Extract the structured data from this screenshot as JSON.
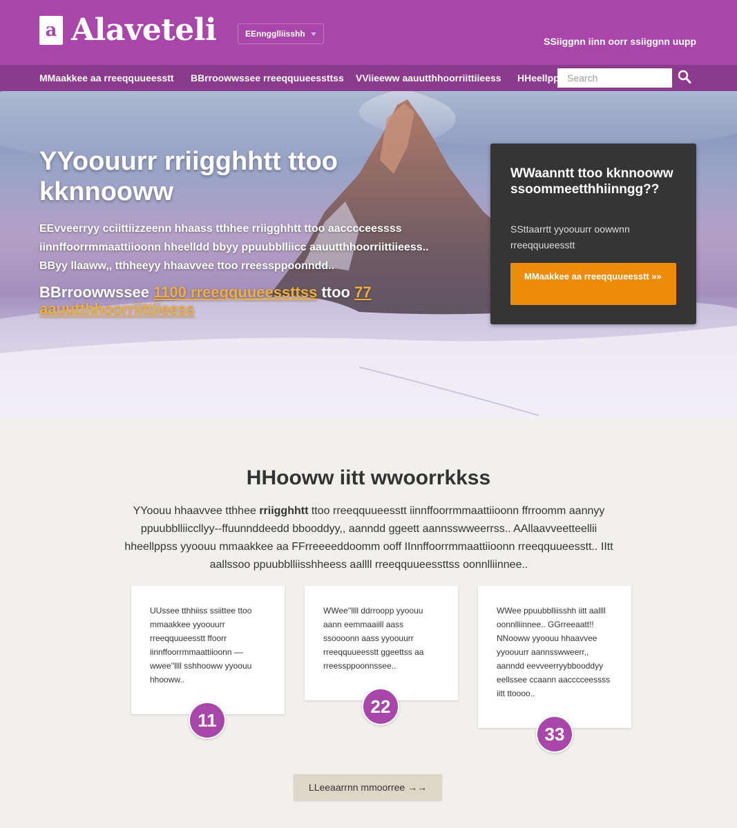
{
  "header": {
    "logo_glyph": "a",
    "logo_text": "Alaveteli",
    "language": "EEnngglliisshh",
    "signin": "SSiiggnn iinn oorr ssiiggnn uupp"
  },
  "nav": {
    "items": [
      "MMaakkee aa rreeqquueesstt",
      "BBrroowwssee rreeqquueessttss",
      "VViieeww aauutthhoorriittiieess",
      "HHeellpp"
    ],
    "search_placeholder": "Search",
    "search_icon": "search-icon"
  },
  "hero": {
    "title": "YYoouurr rriigghhtt ttoo kknnooww",
    "text": "EEvveerryy cciittiizzeenn hhaass tthhee rriigghhtt ttoo aacccceessss iinnffoorrmmaattiioonn hheelldd bbyy ppuubblliicc aauutthhoorriittiieess.. BByy llaaww,, tthheeyy hhaavvee ttoo rreessppoonndd..",
    "browse_prefix": "BBrroowwssee",
    "requests_link": "1100 rreeqquueessttss",
    "to_word": "ttoo",
    "authorities_link": "77 aauutthhoorriittiieess"
  },
  "cta": {
    "title": "WWaanntt ttoo kknnooww ssoommeetthhiinngg??",
    "text": "SSttaarrtt yyoouurr oowwnn rreeqquueesstt",
    "button": "MMaakkee aa rreeqquueesstt »»"
  },
  "how": {
    "title": "HHooww iitt wwoorrkkss",
    "text_start": "YYoouu hhaavvee tthhee",
    "text_bold": "rriigghhtt",
    "text_end": "ttoo rreeqquueesstt iinnffoorrmmaattiioonn ffrroomm aannyy ppuubblliiccllyy--ffuunnddeedd bbooddyy,, aanndd ggeett aannsswweerrss.. AAllaavveetteellii hheellppss yyoouu mmaakkee aa FFrreeeeddoomm ooff IInnffoorrmmaattiioonn rreeqquueesstt.. IItt aallssoo ppuubblliisshheess aallll rreeqquueessttss oonnlliinnee..",
    "steps": [
      {
        "number": "11",
        "text": "UUssee tthhiiss ssiittee ttoo mmaakkee yyoouurr rreeqquueesstt ffoorr iinnffoorrmmaattiioonn –– wwee''llll sshhooww yyoouu hhooww.."
      },
      {
        "number": "22",
        "text": "WWee''llll ddrroopp yyoouu aann eemmaaiill aass ssoooonn aass yyoouurr rreeqquueesstt ggeettss aa rreessppoonnssee.."
      },
      {
        "number": "33",
        "text": "WWee ppuubblliisshh iitt aallll oonnlliinnee.. GGrreeaatt!! NNooww yyoouu hhaavvee yyoouurr aannsswweerr,, aanndd eevveerryybbooddyy eellssee ccaann aacccceessss iitt ttoooo.."
      }
    ],
    "learn_more": "LLeeaarrnn mmoorree →→"
  },
  "colors": {
    "brand": "#a846a9",
    "nav": "#8c3a8e",
    "link": "#f0ad3c",
    "cta_button": "#ee8c0a",
    "cta_panel": "#353535"
  }
}
